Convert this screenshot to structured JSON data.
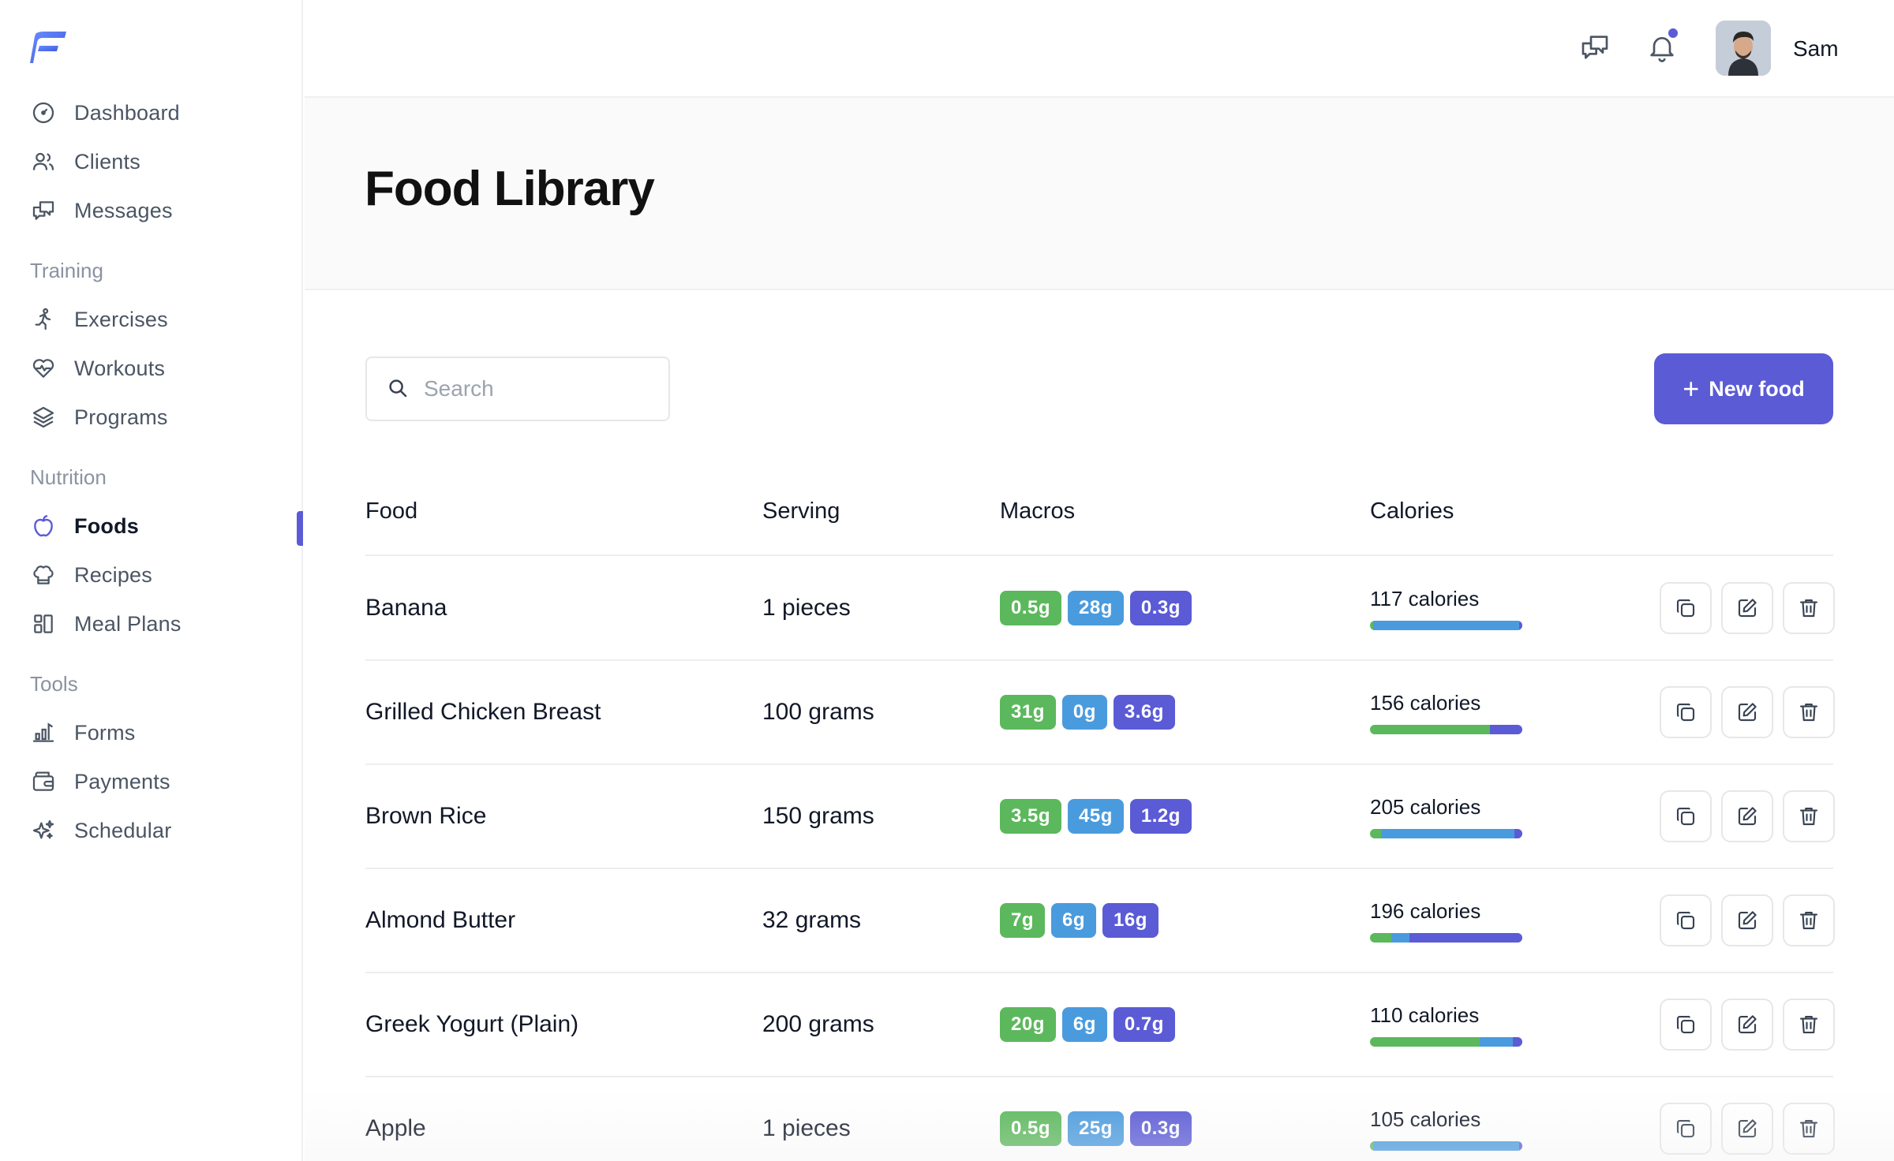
{
  "app": {
    "logo": "fitness-logo"
  },
  "sidebar": {
    "main": [
      {
        "label": "Dashboard",
        "icon": "gauge-icon"
      },
      {
        "label": "Clients",
        "icon": "users-icon"
      },
      {
        "label": "Messages",
        "icon": "chat-icon"
      }
    ],
    "sections": [
      {
        "title": "Training",
        "items": [
          {
            "label": "Exercises",
            "icon": "runner-icon"
          },
          {
            "label": "Workouts",
            "icon": "heart-pulse-icon"
          },
          {
            "label": "Programs",
            "icon": "layers-icon"
          }
        ]
      },
      {
        "title": "Nutrition",
        "items": [
          {
            "label": "Foods",
            "icon": "apple-icon",
            "active": true
          },
          {
            "label": "Recipes",
            "icon": "chef-hat-icon"
          },
          {
            "label": "Meal Plans",
            "icon": "grid-icon"
          }
        ]
      },
      {
        "title": "Tools",
        "items": [
          {
            "label": "Forms",
            "icon": "chart-icon"
          },
          {
            "label": "Payments",
            "icon": "wallet-icon"
          },
          {
            "label": "Schedular",
            "icon": "sparkles-icon"
          }
        ]
      }
    ]
  },
  "topbar": {
    "user_name": "Sam",
    "has_notification": true
  },
  "page": {
    "title": "Food Library"
  },
  "search": {
    "placeholder": "Search",
    "value": ""
  },
  "actions": {
    "new_food_label": "New food"
  },
  "table": {
    "headers": {
      "food": "Food",
      "serving": "Serving",
      "macros": "Macros",
      "calories": "Calories"
    },
    "rows": [
      {
        "food": "Banana",
        "serving": "1 pieces",
        "protein": "0.5g",
        "carbs": "28g",
        "fat": "0.3g",
        "calories": "117 calories",
        "bar": [
          0.02,
          0.96,
          0.02
        ]
      },
      {
        "food": "Grilled Chicken Breast",
        "serving": "100 grams",
        "protein": "31g",
        "carbs": "0g",
        "fat": "3.6g",
        "calories": "156 calories",
        "bar": [
          0.79,
          0.0,
          0.21
        ]
      },
      {
        "food": "Brown Rice",
        "serving": "150 grams",
        "protein": "3.5g",
        "carbs": "45g",
        "fat": "1.2g",
        "calories": "205 calories",
        "bar": [
          0.07,
          0.88,
          0.05
        ]
      },
      {
        "food": "Almond Butter",
        "serving": "32 grams",
        "protein": "7g",
        "carbs": "6g",
        "fat": "16g",
        "calories": "196 calories",
        "bar": [
          0.14,
          0.12,
          0.74
        ]
      },
      {
        "food": "Greek Yogurt (Plain)",
        "serving": "200 grams",
        "protein": "20g",
        "carbs": "6g",
        "fat": "0.7g",
        "calories": "110 calories",
        "bar": [
          0.72,
          0.22,
          0.06
        ]
      },
      {
        "food": "Apple",
        "serving": "1 pieces",
        "protein": "0.5g",
        "carbs": "25g",
        "fat": "0.3g",
        "calories": "105 calories",
        "bar": [
          0.02,
          0.96,
          0.02
        ]
      }
    ]
  },
  "colors": {
    "accent": "#5b5bd6",
    "protein": "#5cb85c",
    "carbs": "#4a9bde",
    "fat": "#5b5bd6"
  }
}
